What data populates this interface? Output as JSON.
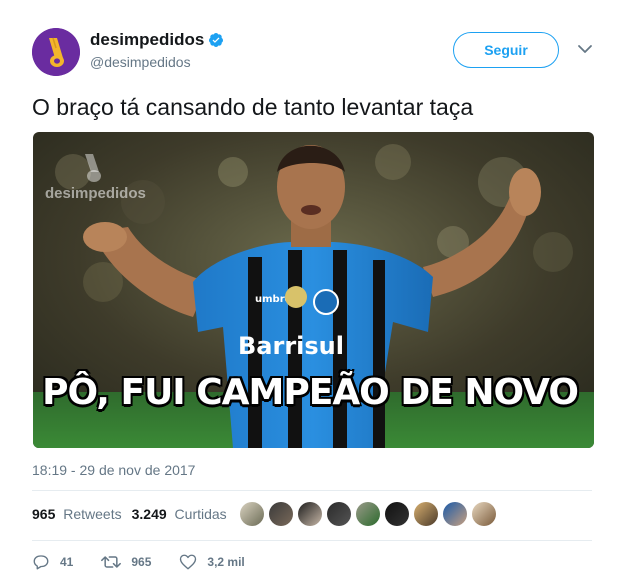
{
  "author": {
    "display_name": "desimpedidos",
    "handle": "@desimpedidos",
    "verified": true
  },
  "follow_button": {
    "label": "Seguir"
  },
  "tweet": {
    "text": "O braço tá cansando de tanto levantar taça"
  },
  "media": {
    "meme_caption": "PÔ, FUI CAMPEÃO DE NOVO",
    "watermark": "desimpedidos",
    "shirt_sponsor": "Barrisul",
    "shirt_brand": "umbro"
  },
  "timestamp": "18:19 - 29 de nov de 2017",
  "stats": {
    "retweets_count": "965",
    "retweets_label": "Retweets",
    "likes_count": "3.249",
    "likes_label": "Curtidas"
  },
  "actions": {
    "replies": "41",
    "retweets": "965",
    "likes": "3,2 mil"
  },
  "colors": {
    "accent": "#1da1f2",
    "text": "#14171a",
    "muted": "#657786",
    "avatar_bg": "#6a2ca0"
  },
  "icons": [
    "verified-badge-icon",
    "chevron-down-icon",
    "reply-icon",
    "retweet-icon",
    "like-icon"
  ]
}
